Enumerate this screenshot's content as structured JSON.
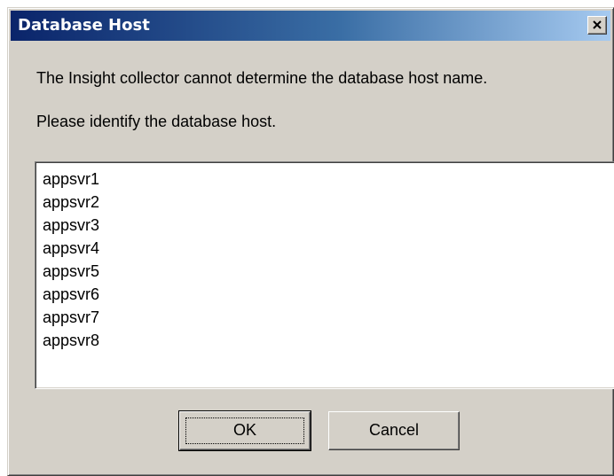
{
  "window": {
    "title": "Database Host",
    "close_icon": "close-icon"
  },
  "message": {
    "line1": "The Insight collector cannot determine the database host name.",
    "line2": "Please identify the database host."
  },
  "hosts": [
    "appsvr1",
    "appsvr2",
    "appsvr3",
    "appsvr4",
    "appsvr5",
    "appsvr6",
    "appsvr7",
    "appsvr8"
  ],
  "buttons": {
    "ok_label": "OK",
    "cancel_label": "Cancel"
  },
  "colors": {
    "titlebar_start": "#0a246a",
    "titlebar_end": "#a6caf0",
    "dialog_face": "#d4d0c8"
  }
}
